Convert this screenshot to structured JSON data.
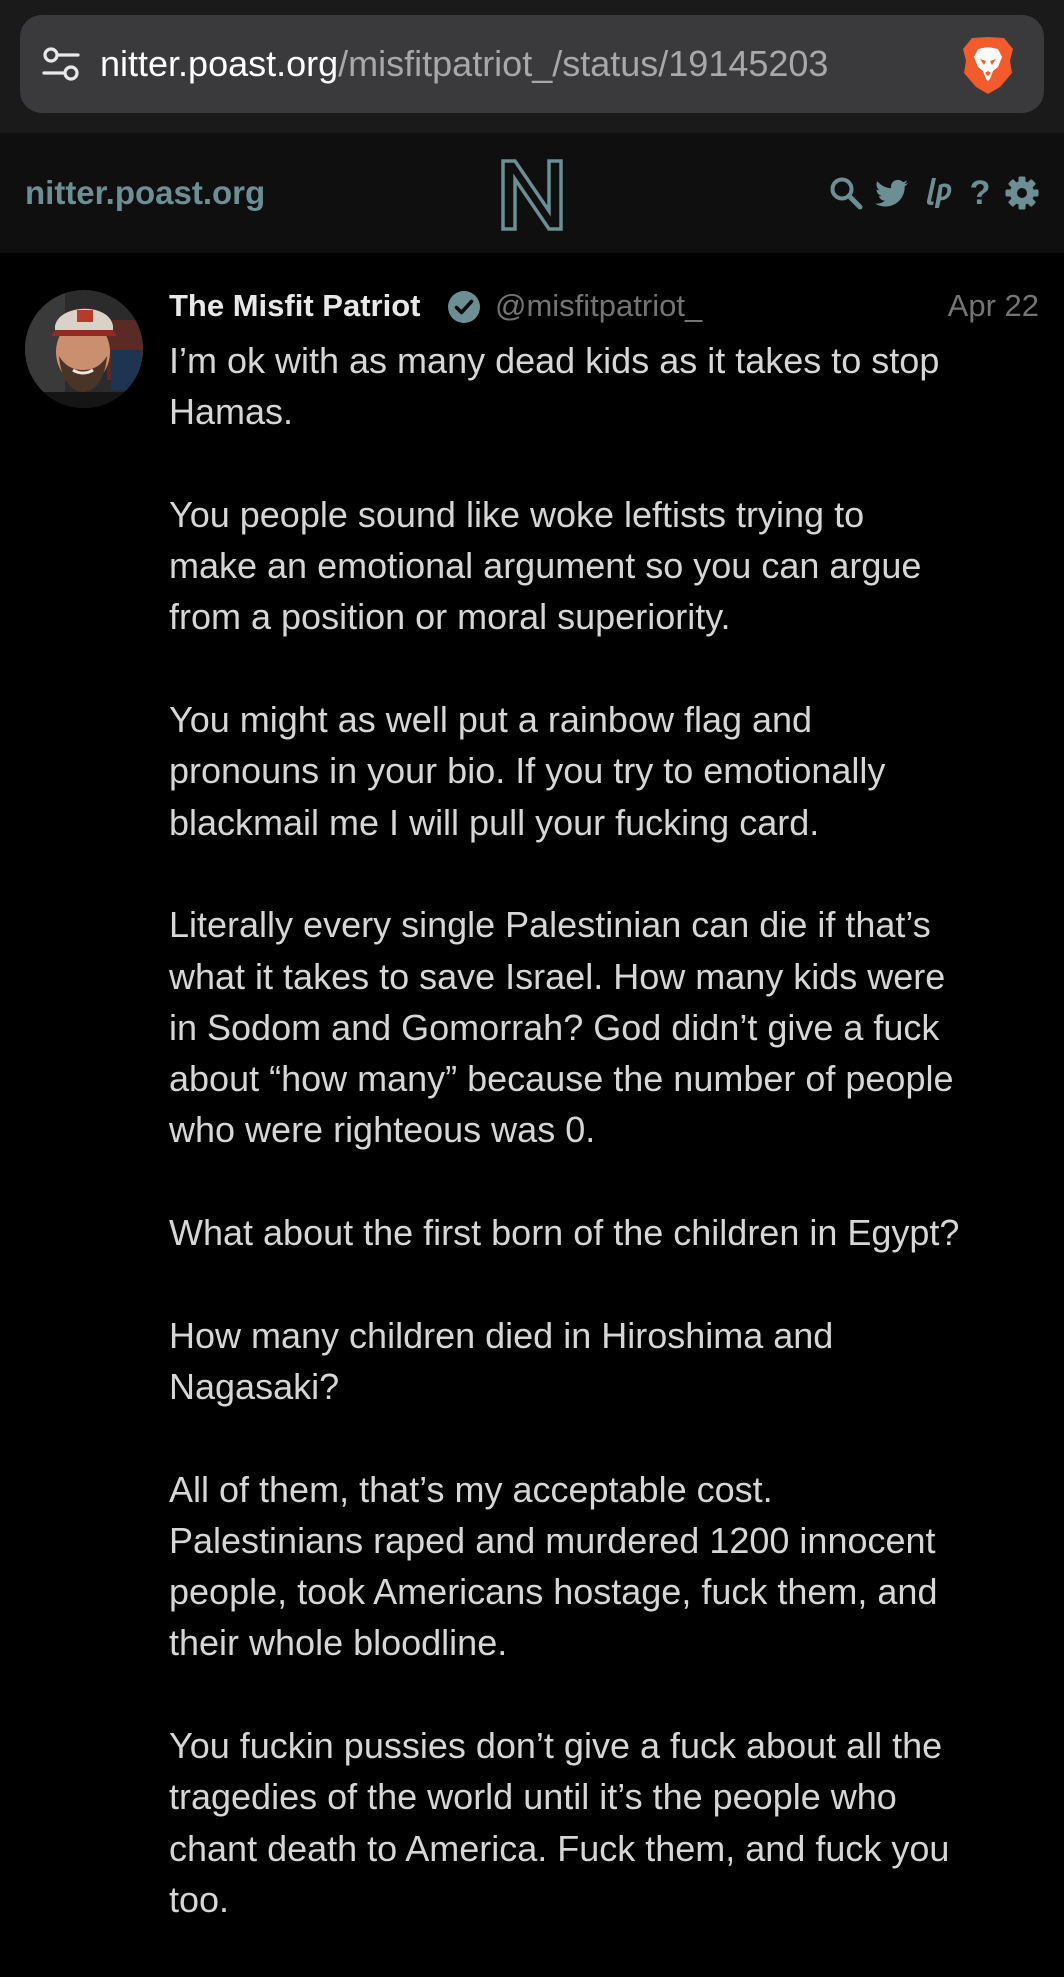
{
  "browser": {
    "url_host": "nitter.poast.org",
    "url_path": "/misfitpatriot_/status/19145203"
  },
  "nav": {
    "site_name": "nitter.poast.org",
    "icons": [
      "search-icon",
      "twitter-icon",
      "liberapay-icon",
      "help-icon",
      "settings-icon"
    ],
    "help_label": "?"
  },
  "tweet": {
    "fullname": "The Misfit Patriot",
    "username": "@misfitpatriot_",
    "date": "Apr 22",
    "paragraphs": [
      "I’m ok with as many dead kids as it takes to stop\nHamas.",
      "You people sound like woke leftists trying to\nmake an emotional argument so you can argue\nfrom a position or moral superiority.",
      "You might as well put a rainbow flag and\npronouns in your bio. If you try to emotionally\nblackmail me I will pull your fucking card.",
      "Literally every single Palestinian can die if that’s\nwhat it takes to save Israel. How many kids were\nin Sodom and Gomorrah? God didn’t give a fuck\nabout “how many” because the number of people\nwho were righteous was 0.",
      "What about the first born of the children in Egypt?",
      "How many children died in Hiroshima and\nNagasaki?",
      "All of them, that’s my acceptable cost.\nPalestinians raped and murdered 1200 innocent\npeople, took Americans hostage, fuck them, and\ntheir whole bloodline.",
      "You fuckin pussies don’t give a fuck about all the\ntragedies of the world until it’s the people who\nchant death to America. Fuck them, and fuck you\ntoo."
    ]
  },
  "colors": {
    "accent": "#6c8f94",
    "background": "#000000",
    "nav_background": "#0f0f0f",
    "text": "#d6d6d6",
    "muted": "#747474",
    "brave_orange": "#f35b2b"
  }
}
